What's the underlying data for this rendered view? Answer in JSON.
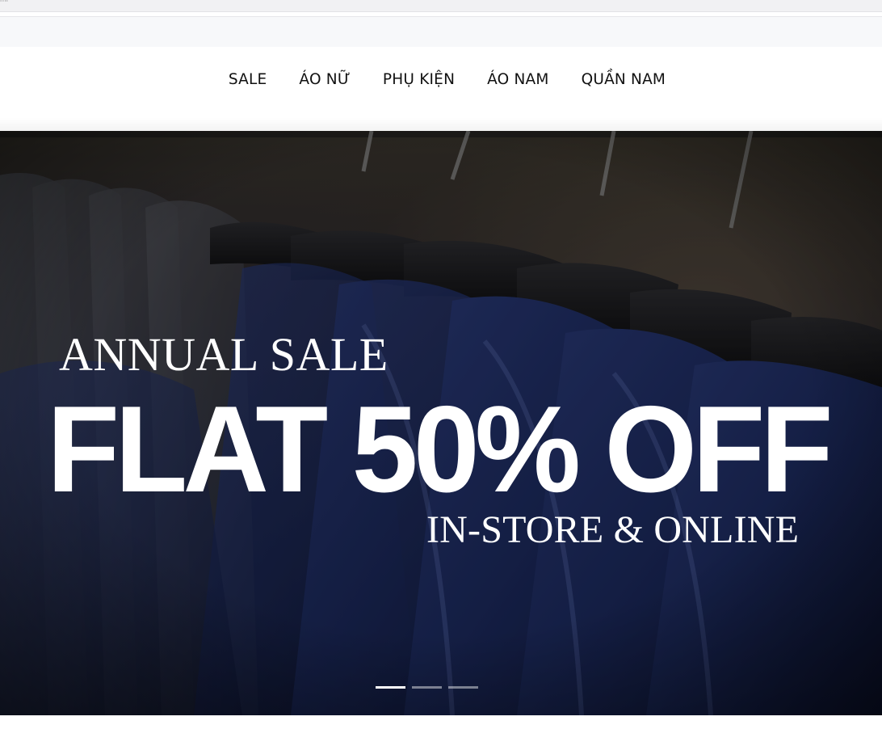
{
  "browser": {
    "tab_stub": "ml"
  },
  "nav": {
    "items": [
      {
        "label": "SALE"
      },
      {
        "label": "ÁO NỮ"
      },
      {
        "label": "PHỤ KIỆN"
      },
      {
        "label": "ÁO NAM"
      },
      {
        "label": "QUẦN NAM"
      }
    ]
  },
  "hero": {
    "line1": "ANNUAL SALE",
    "line2": "FLAT 50% OFF",
    "line3": "IN-STORE & ONLINE",
    "slide_count": 3,
    "active_slide": 1
  },
  "colors": {
    "nav_text": "#111111",
    "hero_text": "#ffffff",
    "indicator_active": "#ffffff",
    "indicator_inactive": "rgba(255,255,255,0.45)"
  }
}
